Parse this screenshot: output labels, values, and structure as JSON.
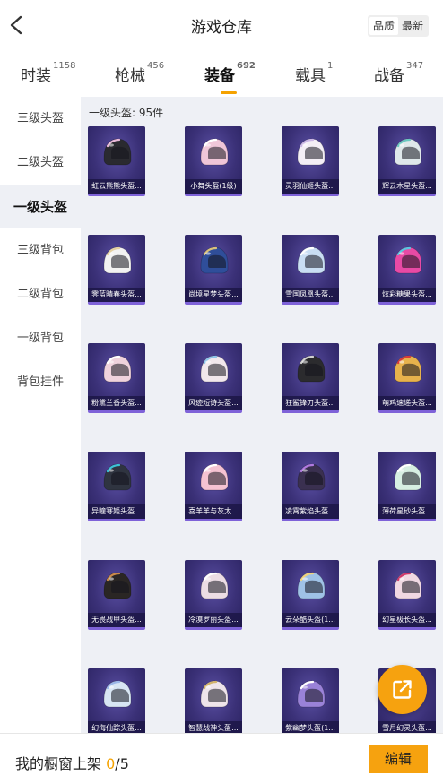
{
  "header": {
    "title": "游戏仓库",
    "sort": [
      "品质",
      "最新"
    ],
    "active_sort": 0
  },
  "tabs": [
    {
      "label": "时装",
      "count": "1158"
    },
    {
      "label": "枪械",
      "count": "456"
    },
    {
      "label": "装备",
      "count": "692"
    },
    {
      "label": "载具",
      "count": "1"
    },
    {
      "label": "战备",
      "count": "347"
    }
  ],
  "active_tab": 2,
  "sidebar": {
    "items": [
      "三级头盔",
      "二级头盔",
      "一级头盔",
      "三级背包",
      "二级背包",
      "一级背包",
      "背包挂件"
    ],
    "active": 2
  },
  "content": {
    "count_label": "一级头盔: 95件",
    "items": [
      {
        "name": "虹云熊熊头盔...",
        "color": "#2a2a30",
        "accent": "#e9b8d9"
      },
      {
        "name": "小舞头盔(1级)",
        "color": "#f0c6d8",
        "accent": "#ffffff"
      },
      {
        "name": "灵羽仙姬头盔...",
        "color": "#f3eef5",
        "accent": "#cbb7e6"
      },
      {
        "name": "辉云木星头盔...",
        "color": "#dfe8ea",
        "accent": "#6ac8c0"
      },
      {
        "name": "霁蓝晴春头盔...",
        "color": "#f2f2f2",
        "accent": "#e4d0a0"
      },
      {
        "name": "尚境星梦头盔...",
        "color": "#2f4e9a",
        "accent": "#d9c07a"
      },
      {
        "name": "雪国凤凰头盔...",
        "color": "#c9def3",
        "accent": "#ffffff"
      },
      {
        "name": "炫彩糖果头盔...",
        "color": "#e84aa5",
        "accent": "#58c7e0"
      },
      {
        "name": "粉黛兰香头盔...",
        "color": "#efd2dc",
        "accent": "#ffffff"
      },
      {
        "name": "风迹短诗头盔...",
        "color": "#f1e7ec",
        "accent": "#8fc4e8"
      },
      {
        "name": "狂鲨锋刃头盔...",
        "color": "#2b2b2e",
        "accent": "#d0d0d0"
      },
      {
        "name": "萌鸡速递头盔...",
        "color": "#e7b24c",
        "accent": "#d93a3a"
      },
      {
        "name": "异瞳寒姬头盔...",
        "color": "#2f3440",
        "accent": "#3cc1d6"
      },
      {
        "name": "喜羊羊与灰太...",
        "color": "#f5c3d2",
        "accent": "#ffffff"
      },
      {
        "name": "凌霄紫焰头盔...",
        "color": "#3a3050",
        "accent": "#b07ae0"
      },
      {
        "name": "薄荷星砂头盔...",
        "color": "#d6efe2",
        "accent": "#ffffff"
      },
      {
        "name": "无畏战甲头盔...",
        "color": "#2a2624",
        "accent": "#c98a4b"
      },
      {
        "name": "冷漠罗丽头盔...",
        "color": "#ecdde4",
        "accent": "#ffffff"
      },
      {
        "name": "云朵酷头盔(1...",
        "color": "#9fc2e6",
        "accent": "#f1d27a"
      },
      {
        "name": "幻星极长头盔...",
        "color": "#f0d8e2",
        "accent": "#d0376a"
      },
      {
        "name": "幻海仙踪头盔...",
        "color": "#d8e6f3",
        "accent": "#9bb7e8"
      },
      {
        "name": "智慧战神头盔...",
        "color": "#eee4ea",
        "accent": "#d2b26a"
      },
      {
        "name": "紫幽梦头盔(1...",
        "color": "#9a82d8",
        "accent": "#ffffff"
      },
      {
        "name": "雪月幻灵头盔...",
        "color": "#e6e0ea",
        "accent": "#ffffff"
      }
    ]
  },
  "fab": {
    "icon": "share-external-icon",
    "color": "#f6a20f"
  },
  "bottom": {
    "label": "我的橱窗上架",
    "current": "0",
    "total": "/5",
    "edit_label": "编辑"
  }
}
